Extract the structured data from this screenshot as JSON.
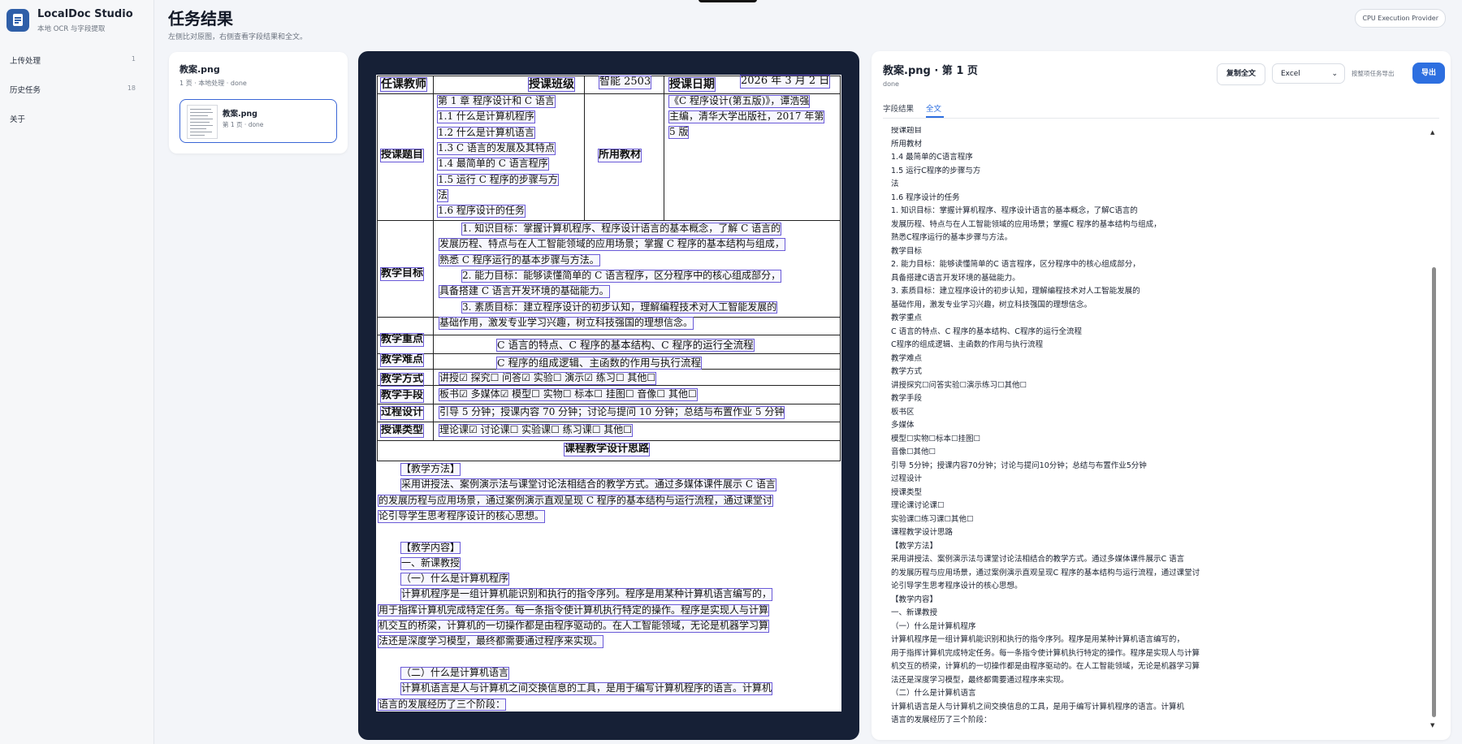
{
  "app": {
    "title": "LocalDoc Studio",
    "subtitle": "本地 OCR 与字段提取"
  },
  "nav": [
    {
      "label": "上传处理",
      "count": "1"
    },
    {
      "label": "历史任务",
      "count": "18"
    },
    {
      "label": "关于",
      "count": ""
    }
  ],
  "header": {
    "title": "任务结果",
    "subtitle": "左侧比对原图，右侧查看字段结果和全文。",
    "provider": "CPU Execution Provider"
  },
  "file": {
    "name": "教案.png",
    "meta": "1 页 · 本地处理 · done",
    "page_title": "教案.png",
    "page_meta": "第 1 页 · done"
  },
  "doc": {
    "header_cells": [
      "任课教师",
      "授课班级",
      "智能 2503",
      "授课日期",
      "2026 年 3 月 2 日"
    ],
    "labels": [
      "授课题目",
      "所用教材",
      "教学目标",
      "教学重点",
      "教学难点",
      "教学方式",
      "教学手段",
      "过程设计",
      "授课类型"
    ],
    "topics": [
      "第 1 章 程序设计和 C 语言",
      "1.1 什么是计算机程序",
      "1.2 什么是计算机语言",
      "1.3 C 语言的发展及其特点",
      "1.4 最简单的 C 语言程序",
      "1.5 运行 C 程序的步骤与方",
      "法",
      "1.6 程序设计的任务"
    ],
    "textbook": [
      "《C 程序设计(第五版)》，谭浩强",
      "主编，清华大学出版社，2017 年第",
      "5 版"
    ],
    "goals": [
      "1. 知识目标：掌握计算机程序、程序设计语言的基本概念，了解 C 语言的",
      "发展历程、特点与在人工智能领域的应用场景；掌握 C 程序的基本结构与组成，",
      "熟悉 C 程序运行的基本步骤与方法。",
      "2. 能力目标：能够读懂简单的 C 语言程序，区分程序中的核心组成部分，",
      "具备搭建 C 语言开发环境的基础能力。",
      "3. 素质目标：建立程序设计的初步认知，理解编程技术对人工智能发展的",
      "基础作用，激发专业学习兴趣，树立科技强国的理想信念。"
    ],
    "key_point": "C 语言的特点、C 程序的基本结构、C 程序的运行全流程",
    "difficulty": "C 程序的组成逻辑、主函数的作用与执行流程",
    "method": "讲授☑ 探究☐ 问答☑ 实验☐ 演示☑ 练习☐ 其他☐",
    "means": "板书☑ 多媒体☑ 模型☐ 实物☐ 标本☐ 挂图☐ 音像☐ 其他☐",
    "process": "引导 5 分钟；授课内容 70 分钟；讨论与提问 10 分钟；总结与布置作业 5 分钟",
    "type": "理论课☑ 讨论课☐ 实验课☐ 练习课☐ 其他☐",
    "design_title": "课程教学设计思路",
    "body": [
      "【教学方法】",
      "采用讲授法、案例演示法与课堂讨论法相结合的教学方式。通过多媒体课件展示 C 语言",
      "的发展历程与应用场景，通过案例演示直观呈现 C 程序的基本结构与运行流程，通过课堂讨",
      "论引导学生思考程序设计的核心思想。",
      "",
      "【教学内容】",
      "一、新课教授",
      "（一）什么是计算机程序",
      "计算机程序是一组计算机能识别和执行的指令序列。程序是用某种计算机语言编写的，",
      "用于指挥计算机完成特定任务。每一条指令使计算机执行特定的操作。程序是实现人与计算",
      "机交互的桥梁，计算机的一切操作都是由程序驱动的。在人工智能领域，无论是机器学习算",
      "法还是深度学习模型，最终都需要通过程序来实现。",
      "",
      "（二）什么是计算机语言",
      "计算机语言是人与计算机之间交换信息的工具，是用于编写计算机程序的语言。计算机",
      "语言的发展经历了三个阶段："
    ]
  },
  "result": {
    "title": "教案.png · 第 1 页",
    "status": "done",
    "copy_label": "复制全文",
    "format": "Excel",
    "export_hint": "按整项任务导出",
    "export_label": "导出",
    "tabs": [
      "字段结果",
      "全文"
    ],
    "fulltext": [
      "授课题目",
      "所用教材",
      "1.4 最简单的C语言程序",
      "1.5 运行C程序的步骤与方",
      "法",
      "1.6 程序设计的任务",
      "1. 知识目标：掌握计算机程序、程序设计语言的基本概念，了解C语言的",
      "发展历程、特点与在人工智能领域的应用场景；掌握C 程序的基本结构与组成，",
      "熟悉C程序运行的基本步骤与方法。",
      "教学目标",
      "2. 能力目标：能够读懂简单的C 语言程序，区分程序中的核心组成部分，",
      "具备搭建C语言开发环境的基础能力。",
      "3. 素质目标：建立程序设计的初步认知，理解编程技术对人工智能发展的",
      "基础作用，激发专业学习兴趣，树立科技强国的理想信念。",
      "教学重点",
      "C 语言的特点、C 程序的基本结构、C程序的运行全流程",
      "C程序的组成逻辑、主函数的作用与执行流程",
      "教学难点",
      "教学方式",
      "讲授探究☐问答实验☐演示练习☐其他☐",
      "教学手段",
      "板书区",
      "多媒体",
      "模型☐实物☐标本☐挂图☐",
      "音像☐其他☐",
      "引导 5分钟；授课内容70分钟；讨论与提问10分钟；总结与布置作业5分钟",
      "过程设计",
      "授课类型",
      "理论课讨论课☐",
      "实验课☐练习课☐其他☐",
      "课程教学设计思路",
      "【教学方法】",
      "采用讲授法、案例演示法与课堂讨论法相结合的教学方式。通过多媒体课件展示C 语言",
      "的发展历程与应用场景，通过案例演示直观呈现C 程序的基本结构与运行流程，通过课堂讨",
      "论引导学生思考程序设计的核心思想。",
      "【教学内容】",
      "一、新课教授",
      "（一）什么是计算机程序",
      "计算机程序是一组计算机能识别和执行的指令序列。程序是用某种计算机语言编写的，",
      "用于指挥计算机完成特定任务。每一条指令使计算机执行特定的操作。程序是实现人与计算",
      "机交互的桥梁，计算机的一切操作都是由程序驱动的。在人工智能领域，无论是机器学习算",
      "法还是深度学习模型，最终都需要通过程序来实现。",
      "（二）什么是计算机语言",
      "计算机语言是人与计算机之间交换信息的工具，是用于编写计算机程序的语言。计算机",
      "语言的发展经历了三个阶段："
    ]
  },
  "colors": {
    "accent": "#2d6fe0",
    "viewer_bg": "#162036",
    "ocr_box": "#6a5ad8"
  }
}
